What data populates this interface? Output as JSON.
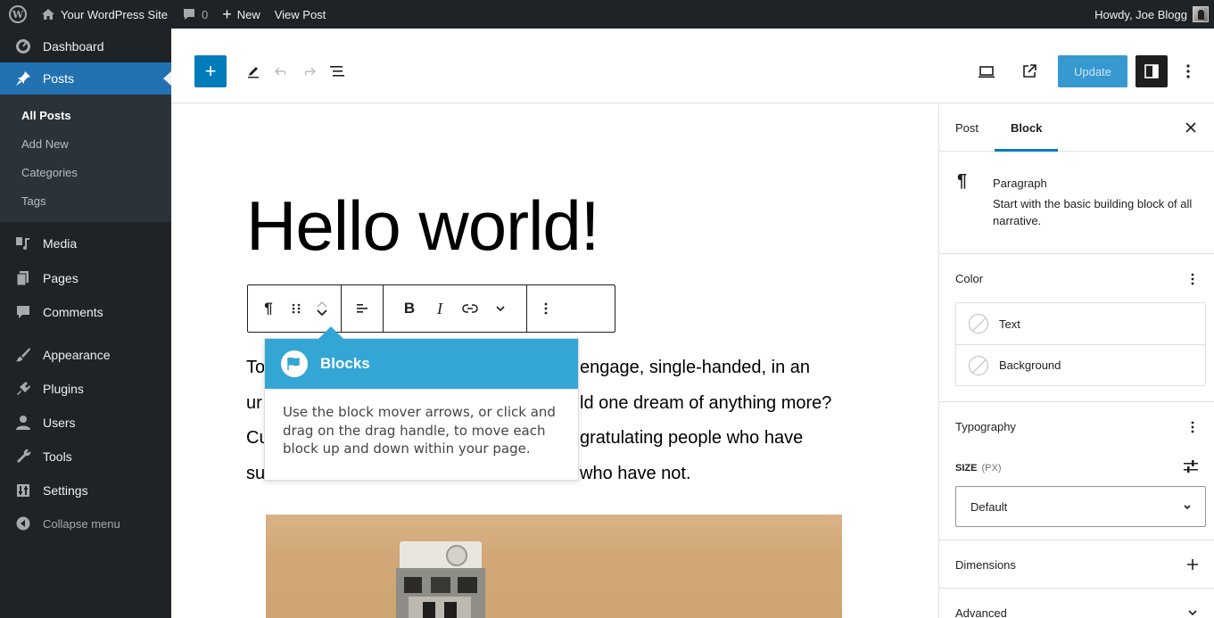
{
  "adminbar": {
    "site_name": "Your WordPress Site",
    "comments_count": "0",
    "new_label": "New",
    "view_post_label": "View Post",
    "greeting": "Howdy, Joe Blogg"
  },
  "menu": {
    "dashboard": "Dashboard",
    "posts": "Posts",
    "posts_sub": [
      "All Posts",
      "Add New",
      "Categories",
      "Tags"
    ],
    "media": "Media",
    "pages": "Pages",
    "comments": "Comments",
    "appearance": "Appearance",
    "plugins": "Plugins",
    "users": "Users",
    "tools": "Tools",
    "settings": "Settings",
    "collapse": "Collapse menu"
  },
  "header": {
    "update_label": "Update"
  },
  "post": {
    "title": "Hello world!",
    "paragraph_lines": [
      "To engage, single-handed, in an",
      "ur ld one dream of anything more?",
      "Cu gratulating people who have",
      "su who have not."
    ],
    "paragraph_left": [
      "To",
      "ur",
      "Cu",
      "su"
    ],
    "paragraph_right": [
      "engage, single-handed, in an",
      "ld one dream of anything more?",
      "gratulating people who have",
      "who have not."
    ]
  },
  "tooltip": {
    "title": "Blocks",
    "body": "Use the block mover arrows, or click and drag on the drag handle, to move each block up and down within your page."
  },
  "sidebar": {
    "tab_post": "Post",
    "tab_block": "Block",
    "block_name": "Paragraph",
    "block_description": "Start with the basic building block of all narrative.",
    "color_panel": "Color",
    "color_text": "Text",
    "color_background": "Background",
    "typography_panel": "Typography",
    "size_label": "Size",
    "size_unit": "(px)",
    "size_value": "Default",
    "dimensions_panel": "Dimensions",
    "advanced_panel": "Advanced"
  },
  "colors": {
    "admin_bar": "#1d2327",
    "accent": "#2271b1",
    "inserter": "#007cba",
    "tooltip_head": "#33a6d6",
    "update": "#3699cf"
  }
}
